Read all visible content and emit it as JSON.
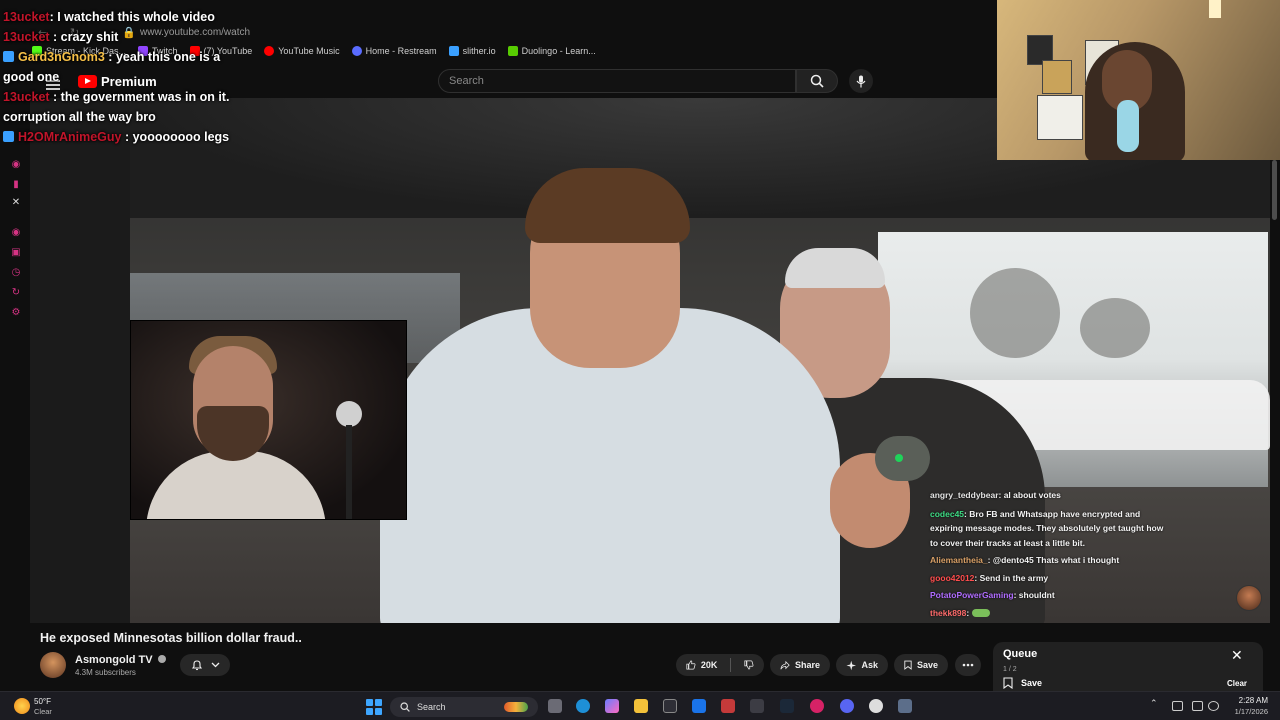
{
  "browser": {
    "url": "www.youtube.com/watch",
    "bookmarks": [
      {
        "label": "Stream - Kick Das...",
        "color": "#53fc18"
      },
      {
        "label": "Twitch",
        "color": "#9146ff"
      },
      {
        "label": "(7) YouTube",
        "color": "#ff0000"
      },
      {
        "label": "YouTube Music",
        "color": "#ff0000"
      },
      {
        "label": "Home - Restream",
        "color": "#5a6cff"
      },
      {
        "label": "slither.io",
        "color": "#3aa0ff"
      },
      {
        "label": "Duolingo - Learn...",
        "color": "#58cc02"
      }
    ]
  },
  "youtube": {
    "logo_text": "Premium",
    "search_placeholder": "Search"
  },
  "overlay_chat": [
    {
      "user": "13ucket",
      "text": "I watched this whole video"
    },
    {
      "user": "13ucket",
      "text": "crazy shit"
    },
    {
      "user": "Gard3nGnom3",
      "text": "yeah this one is a",
      "cont": "good one"
    },
    {
      "user": "13ucket",
      "text": "the government was in on it.",
      "cont": "corruption all the way bro"
    },
    {
      "user": "H2OMrAnimeGuy",
      "text": "yoooooooo legs"
    }
  ],
  "stream_chat": [
    {
      "user": "angry_teddybear",
      "text": "al about votes",
      "color": "#e3e3e3"
    },
    {
      "user": "codec45",
      "text": "Bro FB and Whatsapp have encrypted and expiring message modes. They absolutely get taught how to cover their tracks at least a little bit.",
      "color": "#3ddc84"
    },
    {
      "user": "Aliemantheia_",
      "text": "@dento45 Thats what i thought",
      "color": "#d9a066"
    },
    {
      "user": "gooo42012",
      "text": "Send in the army",
      "color": "#ff4d4d"
    },
    {
      "user": "PotatoPowerGaming",
      "text": "shouldnt",
      "color": "#b06cff"
    },
    {
      "user": "thekk898",
      "text": "",
      "color": "#ff6b6b"
    }
  ],
  "video": {
    "title": "He exposed Minnesotas billion dollar fraud..",
    "channel": "Asmongold TV",
    "subscribers": "4.3M subscribers"
  },
  "actions": {
    "likes": "20K",
    "share": "Share",
    "ask": "Ask",
    "save": "Save"
  },
  "queue": {
    "title": "Queue",
    "count": "1 / 2",
    "save": "Save",
    "clear": "Clear"
  },
  "taskbar": {
    "temp": "50°F",
    "weather": "Clear",
    "search": "Search",
    "time": "2:28 AM",
    "date": "1/17/2026"
  },
  "colors": {
    "accent_red": "#ff0000",
    "chat_user_red": "#c0152a",
    "chat_user_gold": "#f6c048",
    "win_blue": "#3ea6ff"
  }
}
